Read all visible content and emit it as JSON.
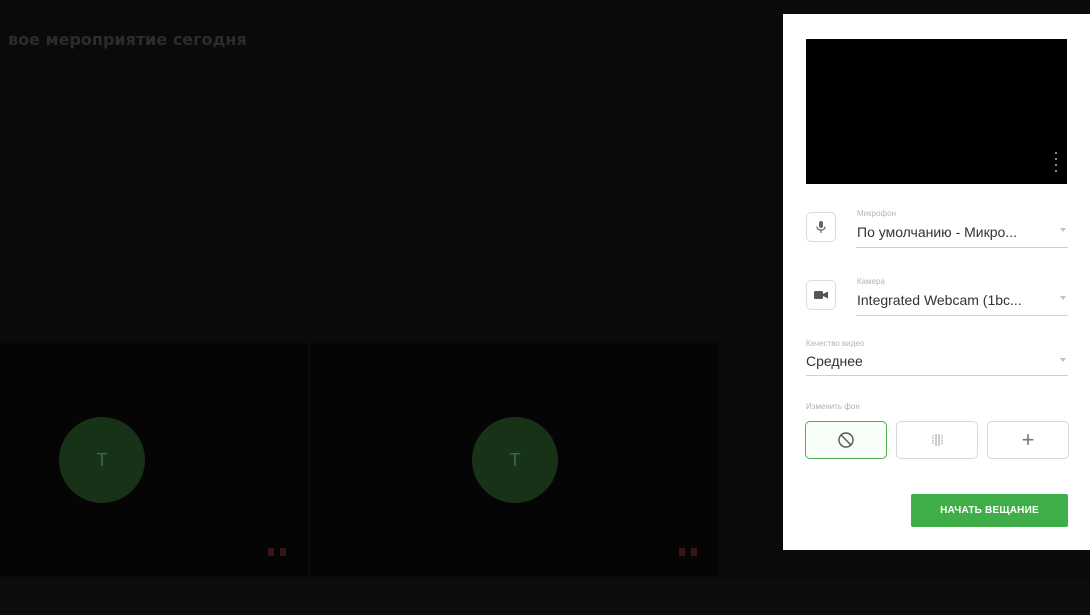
{
  "event": {
    "title": "вое мероприятие сегодня"
  },
  "participants": [
    {
      "initial": "T"
    },
    {
      "initial": "T"
    }
  ],
  "settings": {
    "microphone": {
      "label": "Микрофон",
      "value": "По умолчанию - Микро..."
    },
    "camera": {
      "label": "Камера",
      "value": "Integrated Webcam (1bc..."
    },
    "quality": {
      "label": "Качество видео",
      "value": "Среднее"
    },
    "background": {
      "label": "Изменить фон",
      "add_symbol": "+"
    },
    "start_label": "НАЧАТЬ ВЕЩАНИЕ"
  },
  "colors": {
    "accent": "#3fae49",
    "avatar_bg": "#183218",
    "panel_bg": "#ffffff",
    "stage_bg": "#0a0a0a"
  },
  "icons": [
    "microphone-icon",
    "camera-icon",
    "no-background-icon",
    "blur-background-icon",
    "add-background-icon",
    "more-options-icon",
    "mic-muted-icon",
    "camera-off-icon"
  ]
}
